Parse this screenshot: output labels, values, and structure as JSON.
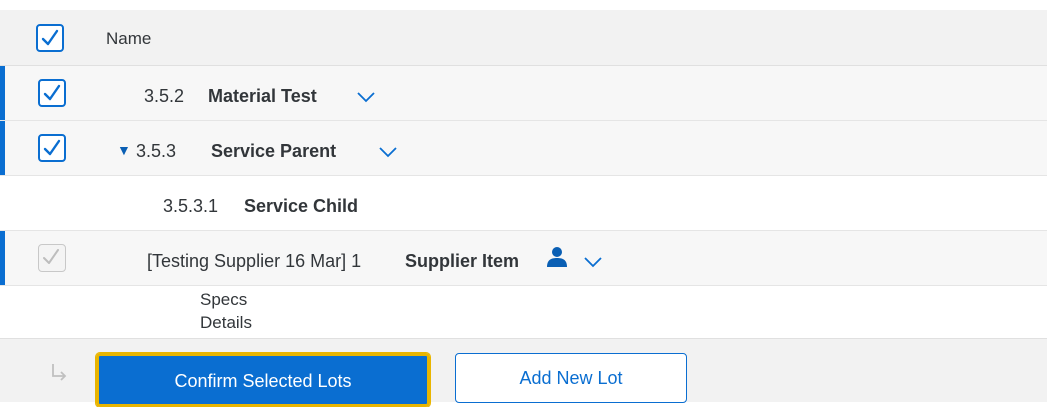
{
  "table": {
    "header": {
      "name_label": "Name"
    },
    "rows": [
      {
        "number": "3.5.2",
        "name": "Material Test"
      },
      {
        "number": "3.5.3",
        "name": "Service Parent"
      },
      {
        "number": "3.5.3.1",
        "name": "Service Child"
      },
      {
        "number": "[Testing Supplier 16 Mar] 1",
        "name": "Supplier Item"
      }
    ],
    "details_lines": [
      "Specs",
      "Details"
    ]
  },
  "actions": {
    "confirm_label": "Confirm Selected Lots",
    "add_label": "Add New Lot"
  },
  "icons": {
    "checkbox": "check-icon",
    "expand": "chevron-down-icon",
    "collapse": "triangle-down-icon",
    "supplier": "person-icon",
    "return": "return-arrow-icon"
  },
  "colors": {
    "accent": "#0a6ed1",
    "focus": "#e9b500"
  }
}
